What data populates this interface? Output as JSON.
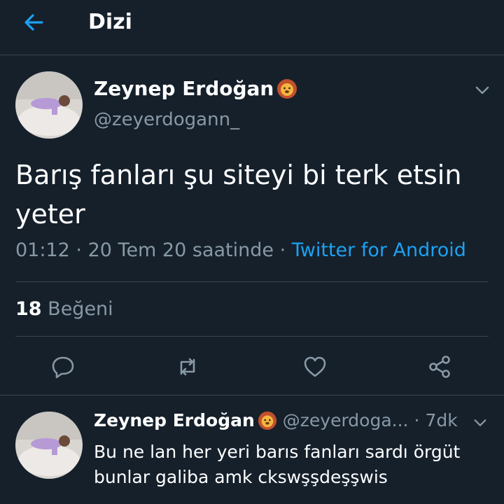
{
  "header": {
    "title": "Dizi"
  },
  "tweet": {
    "author_name": "Zeynep Erdoğan",
    "author_handle": "@zeyerdogann_",
    "text": "Barış fanları şu siteyi bi terk etsin yeter",
    "time": "01:12",
    "date": "20 Tem 20 saatinde",
    "separator": "·",
    "source": "Twitter for Android",
    "like_count": "18",
    "like_label": "Beğeni"
  },
  "reply": {
    "author_name": "Zeynep Erdoğan",
    "author_handle": "@zeyerdoga...",
    "time_ago": "7dk",
    "separator": "·",
    "text": "Bu ne lan her yeri barıs fanları sardı örgüt bunlar galiba amk ckswşşdeşşwis"
  },
  "icons": {
    "back": "arrow-left-icon",
    "badge": "lion-emoji-icon",
    "more": "chevron-down-icon",
    "reply": "reply-icon",
    "retweet": "retweet-icon",
    "like": "heart-icon",
    "share": "share-icon"
  },
  "colors": {
    "background": "#15202b",
    "accent": "#1da1f2",
    "secondary_text": "#8899a6",
    "divider": "#38444d"
  }
}
